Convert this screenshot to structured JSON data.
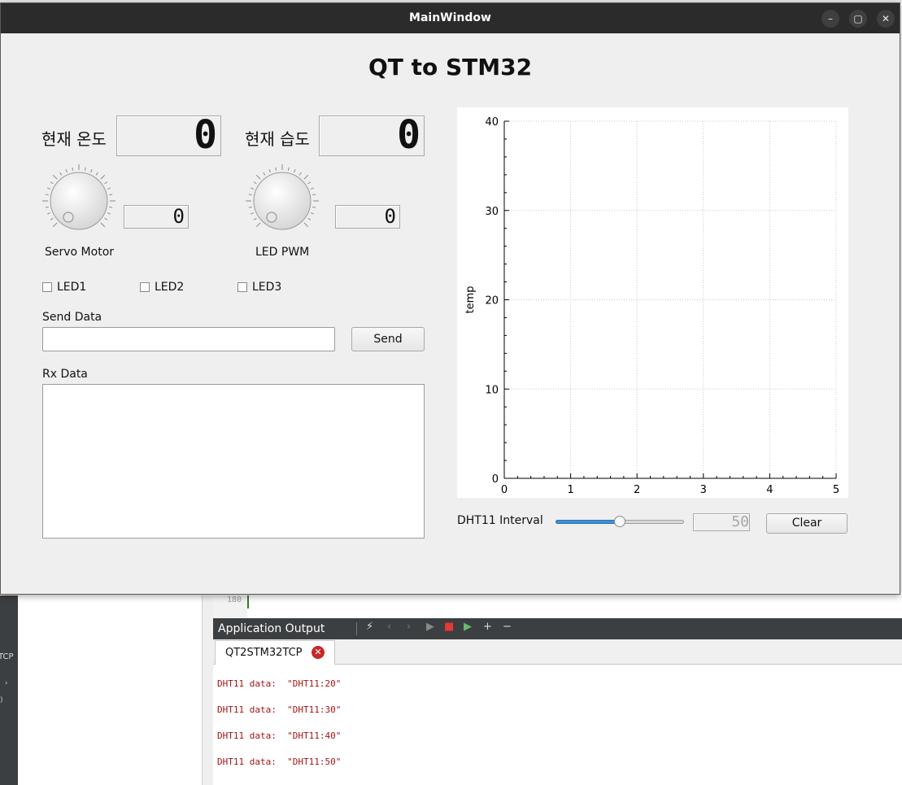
{
  "window": {
    "title": "MainWindow",
    "minimize_icon": "–",
    "maximize_icon": "▢",
    "close_icon": "✕"
  },
  "app": {
    "title": "QT to STM32"
  },
  "temperature": {
    "label": "현재 온도",
    "value": "0"
  },
  "humidity": {
    "label": "현재 습도",
    "value": "0"
  },
  "servo": {
    "label": "Servo Motor",
    "value": "0"
  },
  "led_pwm": {
    "label": "LED PWM",
    "value": "0"
  },
  "leds": [
    {
      "label": "LED1",
      "checked": false
    },
    {
      "label": "LED2",
      "checked": false
    },
    {
      "label": "LED3",
      "checked": false
    }
  ],
  "send": {
    "label": "Send Data",
    "value": "",
    "button_label": "Send"
  },
  "rx": {
    "label": "Rx Data",
    "value": ""
  },
  "chart_data": {
    "type": "line",
    "ylabel": "temp",
    "xlabel": "",
    "xlim": [
      0,
      5
    ],
    "ylim": [
      0,
      40
    ],
    "x_ticks": [
      "0",
      "1",
      "2",
      "3",
      "4",
      "5"
    ],
    "y_ticks": [
      "0",
      "10",
      "20",
      "30",
      "40"
    ],
    "grid": true,
    "series": []
  },
  "interval": {
    "label": "DHT11 Interval",
    "value": "50",
    "fraction": 0.5,
    "clear_label": "Clear"
  },
  "ide": {
    "output_title": "Application Output",
    "tab_label": "QT2STM32TCP",
    "tab_close_icon": "✕",
    "line_number": "180",
    "left_text": "TCP",
    "left_arrow": "›",
    "left_paren": ")",
    "toolbar": [
      "⚡",
      "‹",
      "›",
      "▶",
      "■",
      "▶",
      "+",
      "−"
    ],
    "output_lines": [
      "DHT11 data:  \"DHT11:20\"",
      "DHT11 data:  \"DHT11:30\"",
      "DHT11 data:  \"DHT11:40\"",
      "DHT11 data:  \"DHT11:50\""
    ]
  },
  "colors": {
    "accent": "#3f8fd8",
    "output_text": "#a31515",
    "close_red": "#c62828"
  }
}
